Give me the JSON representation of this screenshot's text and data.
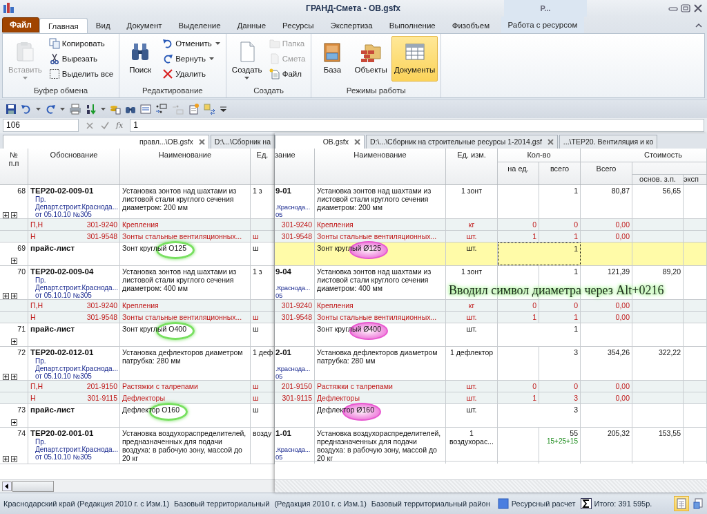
{
  "window": {
    "title": "ГРАНД-Смета - ОВ.gsfx",
    "context_group": "Р..."
  },
  "ribbon_tabs": [
    {
      "label": "Файл",
      "kind": "file",
      "selected": false
    },
    {
      "label": "Главная",
      "kind": "tab",
      "selected": true
    },
    {
      "label": "Вид",
      "kind": "tab",
      "selected": false
    },
    {
      "label": "Документ",
      "kind": "tab",
      "selected": false
    },
    {
      "label": "Выделение",
      "kind": "tab",
      "selected": false
    },
    {
      "label": "Данные",
      "kind": "tab",
      "selected": false
    },
    {
      "label": "Ресурсы",
      "kind": "tab",
      "selected": false
    },
    {
      "label": "Экспертиза",
      "kind": "tab",
      "selected": false
    },
    {
      "label": "Выполнение",
      "kind": "tab",
      "selected": false
    },
    {
      "label": "Физобъем",
      "kind": "tab",
      "selected": false
    },
    {
      "label": "Работа с ресурсом",
      "kind": "context",
      "selected": false
    }
  ],
  "ribbon_groups": [
    {
      "title": "Буфер обмена",
      "items": [
        {
          "kind": "large",
          "label": "Вставить",
          "disabled": true,
          "dropdown": true
        },
        {
          "kind": "small",
          "label": "Копировать",
          "disabled": false,
          "dropdown": false
        },
        {
          "kind": "small",
          "label": "Вырезать",
          "disabled": false,
          "dropdown": false
        },
        {
          "kind": "small",
          "label": "Выделить все",
          "disabled": false,
          "dropdown": false
        }
      ]
    },
    {
      "title": "Редактирование",
      "items": [
        {
          "kind": "large",
          "label": "Поиск",
          "disabled": false,
          "dropdown": false
        },
        {
          "kind": "small",
          "label": "Отменить",
          "disabled": false,
          "dropdown": true
        },
        {
          "kind": "small",
          "label": "Вернуть",
          "disabled": false,
          "dropdown": true
        },
        {
          "kind": "small",
          "label": "Удалить",
          "disabled": false,
          "dropdown": false
        }
      ]
    },
    {
      "title": "Создать",
      "items": [
        {
          "kind": "large",
          "label": "Создать",
          "disabled": false,
          "dropdown": true
        },
        {
          "kind": "small",
          "label": "Папка",
          "disabled": true,
          "dropdown": false
        },
        {
          "kind": "small",
          "label": "Смета",
          "disabled": true,
          "dropdown": false
        },
        {
          "kind": "small",
          "label": "Файл",
          "disabled": false,
          "dropdown": false
        }
      ]
    },
    {
      "title": "Режимы работы",
      "items": [
        {
          "kind": "large",
          "label": "База",
          "selected": false
        },
        {
          "kind": "large",
          "label": "Объекты",
          "selected": false
        },
        {
          "kind": "large",
          "label": "Документы",
          "selected": true
        }
      ]
    }
  ],
  "formula_bar": {
    "cell": "106",
    "fx": "fx",
    "value": "1"
  },
  "left_pane": {
    "tabs": [
      {
        "label": "правл...\\ОВ.gsfx",
        "selected": true,
        "closable": true
      },
      {
        "label": "D:\\...\\Сборник на",
        "selected": false,
        "closable": false
      }
    ],
    "headers": [
      "№ п.п",
      "Обоснование",
      "Наименование",
      "Ед."
    ],
    "rows": [
      {
        "kind": "work",
        "num": "68",
        "code": "ТЕР20-02-009-01",
        "source": [
          "Пр.",
          "Департ.строит.Краснода...",
          "от 05.10.10 №305"
        ],
        "name": "Установка зонтов над шахтами из листовой стали круглого сечения диаметром: 200 мм",
        "unit": "1 з"
      },
      {
        "kind": "resource",
        "type": "П,Н",
        "code": "301-9240",
        "name": "Крепления"
      },
      {
        "kind": "resource",
        "type": "Н",
        "code": "301-9548",
        "name": "Зонты стальные вентиляционных...",
        "unit": "ш"
      },
      {
        "kind": "price",
        "num": "69",
        "code": "прайс-лист",
        "name": "Зонт круглый O125",
        "unit": "ш",
        "circled": true
      },
      {
        "kind": "work",
        "num": "70",
        "code": "ТЕР20-02-009-04",
        "source": [
          "Пр.",
          "Департ.строит.Краснода...",
          "от 05.10.10 №305"
        ],
        "name": "Установка зонтов над шахтами из листовой стали круглого сечения диаметром: 400 мм",
        "unit": "1 з"
      },
      {
        "kind": "resource",
        "type": "П,Н",
        "code": "301-9240",
        "name": "Крепления"
      },
      {
        "kind": "resource",
        "type": "Н",
        "code": "301-9548",
        "name": "Зонты стальные вентиляционных...",
        "unit": "ш"
      },
      {
        "kind": "price",
        "num": "71",
        "code": "прайс-лист",
        "name": "Зонт круглый O400",
        "unit": "ш",
        "circled": true
      },
      {
        "kind": "work",
        "num": "72",
        "code": "ТЕР20-02-012-01",
        "source": [
          "Пр.",
          "Департ.строит.Краснода...",
          "от 05.10.10 №305"
        ],
        "name": "Установка дефлекторов диаметром патрубка: 280 мм",
        "unit": "1 деф"
      },
      {
        "kind": "resource",
        "type": "П,Н",
        "code": "201-9150",
        "name": "Растяжки с талрепами",
        "unit": "ш"
      },
      {
        "kind": "resource",
        "type": "Н",
        "code": "301-9115",
        "name": "Дефлекторы",
        "unit": "ш"
      },
      {
        "kind": "price",
        "num": "73",
        "code": "прайс-лист",
        "name": "Дефлектор O160",
        "unit": "ш",
        "circled": true
      },
      {
        "kind": "work",
        "num": "74",
        "code": "ТЕР20-02-001-01",
        "source": [
          "Пр.",
          "Департ.строит.Краснода...",
          "от 05.10.10 №305"
        ],
        "name": "Установка воздухораспределителей, предназначенных для подачи воздуха: в рабочую зону, массой до 20 кг",
        "unit": "возду"
      }
    ]
  },
  "right_pane": {
    "tabs": [
      {
        "label": "ОВ.gsfx",
        "selected": true,
        "closable": true
      },
      {
        "label": "D:\\...\\Сборник на строительные ресурсы 1-2014.gsf",
        "selected": false,
        "closable": true
      },
      {
        "label": "...\\ТЕР20. Вентиляция и ко",
        "selected": false,
        "closable": false
      }
    ],
    "header": {
      "code": "зание",
      "name": "Наименование",
      "unit": "Ед. изм.",
      "qty": "Кол-во",
      "per_unit": "на ед.",
      "qty_total": "всего",
      "cost": "Стоимость",
      "cost_total": "Всего",
      "wage": "основ. з.п.",
      "machine": "эксп"
    },
    "annotation": "Вводил символ диаметра через Alt+0216",
    "rows": [
      {
        "kind": "work",
        "selected": false,
        "code": "9-01",
        "source": [
          ".Краснода...",
          "05"
        ],
        "name": "Установка зонтов над шахтами из листовой стали круглого сечения диаметром: 200 мм",
        "unit": "1 зонт",
        "total_qty": "1",
        "cost": "80,87",
        "wage": "56,65"
      },
      {
        "kind": "resource",
        "selected": false,
        "code": "301-9240",
        "name": "Крепления",
        "unit": "кг",
        "per_unit": "0",
        "total_qty": "0",
        "cost": "0,00"
      },
      {
        "kind": "resource",
        "selected": false,
        "code": "301-9548",
        "name": "Зонты стальные вентиляционных...",
        "unit": "шт.",
        "per_unit": "1",
        "total_qty": "1",
        "cost": "0,00"
      },
      {
        "kind": "price",
        "selected": true,
        "name": "Зонт круглый Ø125",
        "unit": "шт.",
        "total_qty": "1",
        "circled": true
      },
      {
        "kind": "work",
        "selected": false,
        "code": "9-04",
        "source": [
          ".Краснода...",
          "05"
        ],
        "name": "Установка зонтов над шахтами из листовой стали круглого сечения диаметром: 400 мм",
        "unit": "1 зонт",
        "total_qty": "1",
        "cost": "121,39",
        "wage": "89,20"
      },
      {
        "kind": "resource",
        "selected": false,
        "code": "301-9240",
        "name": "Крепления",
        "unit": "кг",
        "per_unit": "0",
        "total_qty": "0",
        "cost": "0,00"
      },
      {
        "kind": "resource",
        "selected": false,
        "code": "301-9548",
        "name": "Зонты стальные вентиляционных...",
        "unit": "шт.",
        "per_unit": "1",
        "total_qty": "1",
        "cost": "0,00"
      },
      {
        "kind": "price",
        "selected": false,
        "name": "Зонт круглый Ø400",
        "unit": "шт.",
        "total_qty": "1",
        "circled": true
      },
      {
        "kind": "work",
        "selected": false,
        "code": "2-01",
        "source": [
          ".Краснода...",
          "05"
        ],
        "name": "Установка дефлекторов диаметром патрубка: 280 мм",
        "unit": "1 дефлектор",
        "total_qty": "3",
        "cost": "354,26",
        "wage": "322,22"
      },
      {
        "kind": "resource",
        "selected": false,
        "code": "201-9150",
        "name": "Растяжки с талрепами",
        "unit": "шт.",
        "per_unit": "0",
        "total_qty": "0",
        "cost": "0,00"
      },
      {
        "kind": "resource",
        "selected": false,
        "code": "301-9115",
        "name": "Дефлекторы",
        "unit": "шт.",
        "per_unit": "1",
        "total_qty": "3",
        "cost": "0,00"
      },
      {
        "kind": "price",
        "selected": false,
        "name": "Дефлектор Ø160",
        "unit": "шт.",
        "total_qty": "3",
        "circled": true
      },
      {
        "kind": "work",
        "selected": false,
        "code": "1-01",
        "source": [
          ".Краснода...",
          "05"
        ],
        "name": "Установка воздухораспределителей, предназначенных для подачи воздуха: в рабочую зону, массой до 20 кг",
        "unit": "1 воздухорас...",
        "total_qty": "55",
        "formula": "15+25+15",
        "cost": "205,32",
        "wage": "153,55"
      }
    ]
  },
  "status_bar": {
    "items": [
      {
        "kind": "text",
        "label": "Краснодарский край (Редакция 2010 г. с Изм.1)"
      },
      {
        "kind": "text",
        "label": "Базовый территориальный"
      },
      {
        "kind": "text",
        "label": "(Редакция 2010 г. с Изм.1)"
      },
      {
        "kind": "text",
        "label": "Базовый территориальный район"
      },
      {
        "kind": "mode",
        "label": "Ресурсный расчет"
      },
      {
        "kind": "total",
        "label": "Итого: 391 595р."
      }
    ],
    "views": [
      {
        "selected": true
      },
      {
        "selected": false
      }
    ]
  }
}
